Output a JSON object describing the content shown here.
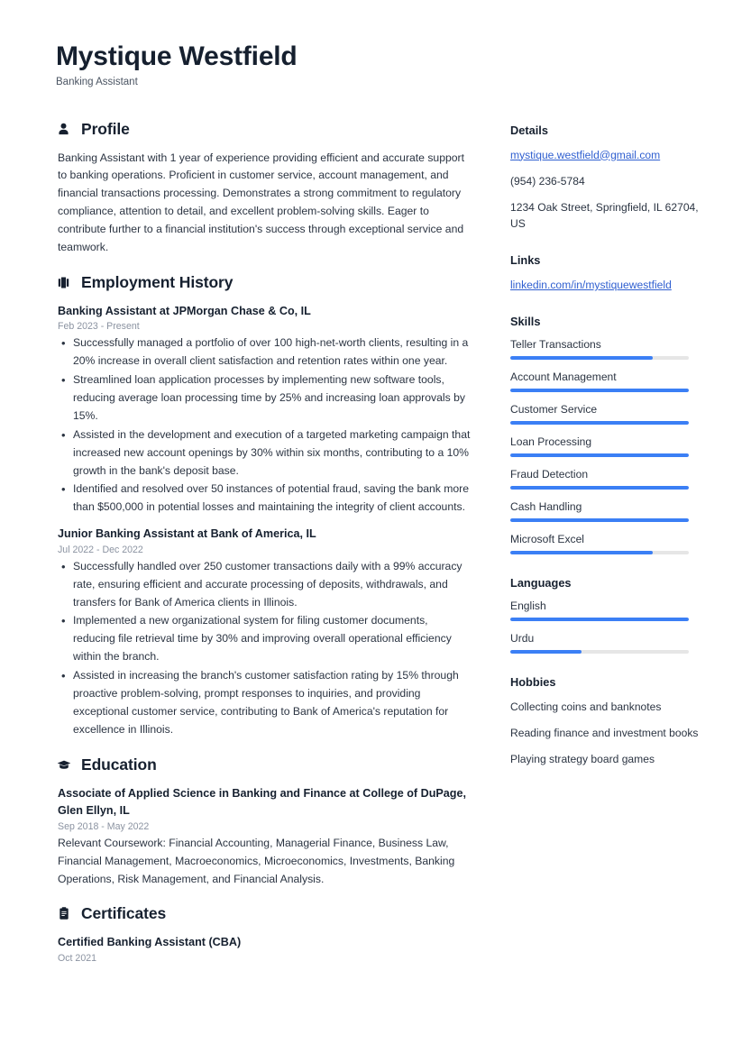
{
  "header": {
    "name": "Mystique Westfield",
    "title": "Banking Assistant"
  },
  "accent_color": "#3b7ff5",
  "link_color": "#2f5fd0",
  "main": {
    "profile": {
      "heading": "Profile",
      "icon": "person-icon",
      "text": "Banking Assistant with 1 year of experience providing efficient and accurate support to banking operations. Proficient in customer service, account management, and financial transactions processing. Demonstrates a strong commitment to regulatory compliance, attention to detail, and excellent problem-solving skills. Eager to contribute further to a financial institution's success through exceptional service and teamwork."
    },
    "employment": {
      "heading": "Employment History",
      "icon": "briefcase-icon",
      "entries": [
        {
          "title": "Banking Assistant at JPMorgan Chase & Co, IL",
          "date": "Feb 2023 - Present",
          "bullets": [
            "Successfully managed a portfolio of over 100 high-net-worth clients, resulting in a 20% increase in overall client satisfaction and retention rates within one year.",
            "Streamlined loan application processes by implementing new software tools, reducing average loan processing time by 25% and increasing loan approvals by 15%.",
            "Assisted in the development and execution of a targeted marketing campaign that increased new account openings by 30% within six months, contributing to a 10% growth in the bank's deposit base.",
            "Identified and resolved over 50 instances of potential fraud, saving the bank more than $500,000 in potential losses and maintaining the integrity of client accounts."
          ]
        },
        {
          "title": "Junior Banking Assistant at Bank of America, IL",
          "date": "Jul 2022 - Dec 2022",
          "bullets": [
            "Successfully handled over 250 customer transactions daily with a 99% accuracy rate, ensuring efficient and accurate processing of deposits, withdrawals, and transfers for Bank of America clients in Illinois.",
            "Implemented a new organizational system for filing customer documents, reducing file retrieval time by 30% and improving overall operational efficiency within the branch.",
            "Assisted in increasing the branch's customer satisfaction rating by 15% through proactive problem-solving, prompt responses to inquiries, and providing exceptional customer service, contributing to Bank of America's reputation for excellence in Illinois."
          ]
        }
      ]
    },
    "education": {
      "heading": "Education",
      "icon": "graduation-cap-icon",
      "entries": [
        {
          "title": "Associate of Applied Science in Banking and Finance at College of DuPage, Glen Ellyn, IL",
          "date": "Sep 2018 - May 2022",
          "text": "Relevant Coursework: Financial Accounting, Managerial Finance, Business Law, Financial Management, Macroeconomics, Microeconomics, Investments, Banking Operations, Risk Management, and Financial Analysis."
        }
      ]
    },
    "certificates": {
      "heading": "Certificates",
      "icon": "clipboard-icon",
      "entries": [
        {
          "title": "Certified Banking Assistant (CBA)",
          "date": "Oct 2021"
        }
      ]
    }
  },
  "sidebar": {
    "details": {
      "heading": "Details",
      "email": "mystique.westfield@gmail.com",
      "phone": "(954) 236-5784",
      "address": "1234 Oak Street, Springfield, IL 62704, US"
    },
    "links": {
      "heading": "Links",
      "items": [
        {
          "label": "linkedin.com/in/mystiquewestfield"
        }
      ]
    },
    "skills": {
      "heading": "Skills",
      "items": [
        {
          "label": "Teller Transactions",
          "level": 80
        },
        {
          "label": "Account Management",
          "level": 100
        },
        {
          "label": "Customer Service",
          "level": 100
        },
        {
          "label": "Loan Processing",
          "level": 100
        },
        {
          "label": "Fraud Detection",
          "level": 100
        },
        {
          "label": "Cash Handling",
          "level": 100
        },
        {
          "label": "Microsoft Excel",
          "level": 80
        }
      ]
    },
    "languages": {
      "heading": "Languages",
      "items": [
        {
          "label": "English",
          "level": 100
        },
        {
          "label": "Urdu",
          "level": 40
        }
      ]
    },
    "hobbies": {
      "heading": "Hobbies",
      "items": [
        {
          "label": "Collecting coins and banknotes"
        },
        {
          "label": "Reading finance and investment books"
        },
        {
          "label": "Playing strategy board games"
        }
      ]
    }
  }
}
